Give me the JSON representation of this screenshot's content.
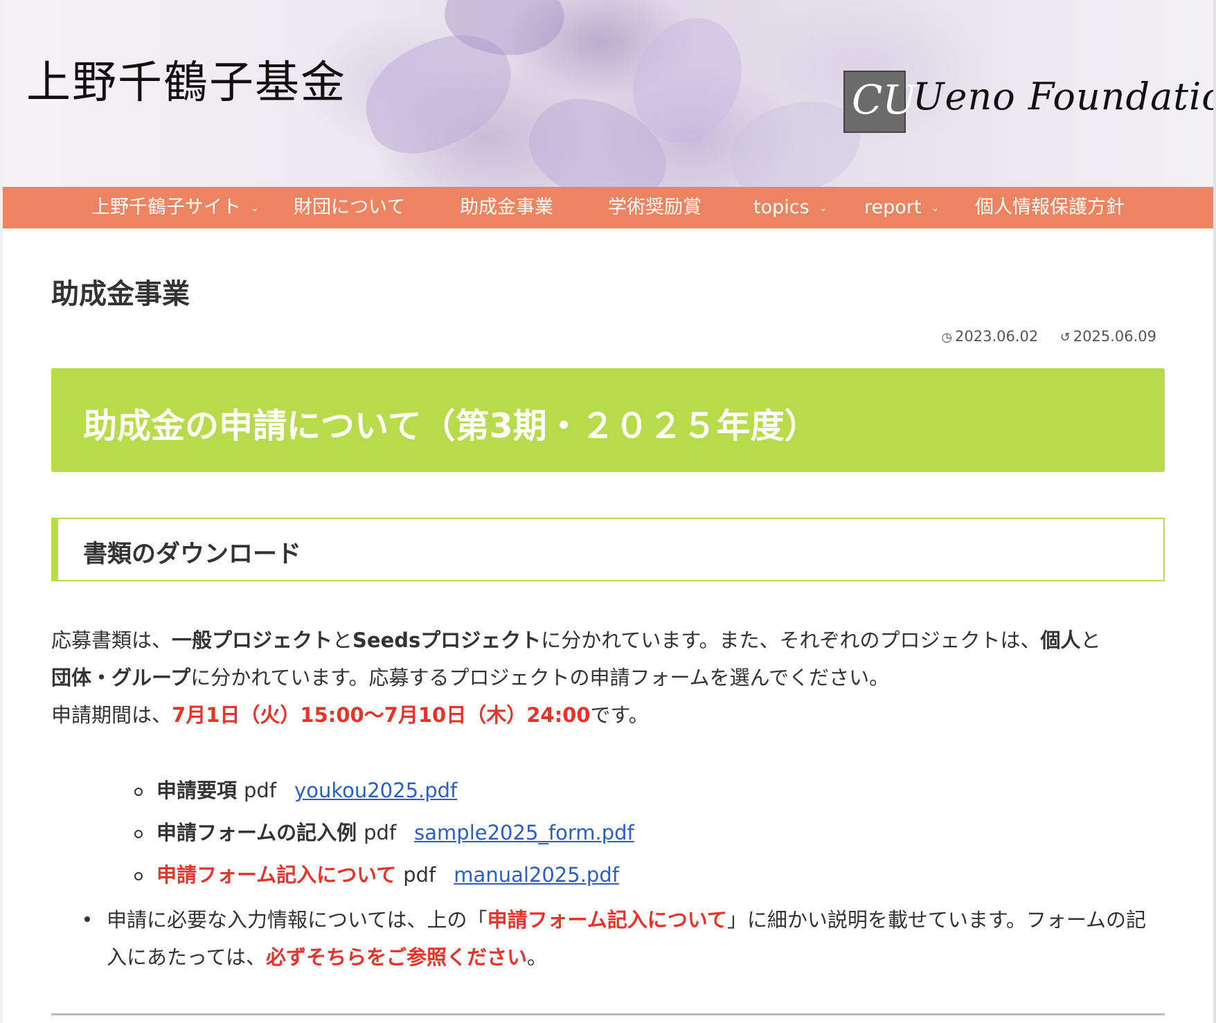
{
  "header": {
    "site_title": "上野千鶴子基金",
    "logo_mark": "CU",
    "logo_text": "Ueno Foundation"
  },
  "nav": {
    "items": [
      {
        "label": "上野千鶴子サイト",
        "has_dropdown": true
      },
      {
        "label": "財団について",
        "has_dropdown": false
      },
      {
        "label": "助成金事業",
        "has_dropdown": false
      },
      {
        "label": "学術奨励賞",
        "has_dropdown": false
      },
      {
        "label": "topics",
        "has_dropdown": true
      },
      {
        "label": "report",
        "has_dropdown": true
      },
      {
        "label": "個人情報保護方針",
        "has_dropdown": false
      }
    ]
  },
  "main": {
    "page_title": "助成金事業",
    "published": "2023.06.02",
    "updated": "2025.06.09",
    "banner_title": "助成金の申請について（第3期・２０２５年度）",
    "section_title": "書類のダウンロード",
    "para": {
      "t1": "応募書類は、",
      "b1": "一般プロジェクト",
      "t2": "と",
      "b2": "Seedsプロジェクト",
      "t3": "に分かれています。また、それぞれのプロジェクトは、",
      "b3": "個人",
      "t4": "と",
      "b4": "団体・グループ",
      "t5": "に分かれています。応募するプロジェクトの申請フォームを選んでください。",
      "t6": "申請期間は、",
      "r1": "7月1日（火）15:00〜7月10日（木）24:00",
      "t7": "です。"
    },
    "downloads": [
      {
        "label": "申請要項",
        "type": "pdf",
        "file": "youkou2025.pdf",
        "highlight": false
      },
      {
        "label": "申請フォームの記入例",
        "type": "pdf",
        "file": "sample2025_form.pdf",
        "highlight": false
      },
      {
        "label": "申請フォーム記入について",
        "type": "pdf",
        "file": "manual2025.pdf",
        "highlight": true
      }
    ],
    "note": {
      "t1": "申請に必要な入力情報については、上の「",
      "r1": "申請フォーム記入について",
      "t2": "」に細かい説明を載せています。フォームの記入にあたっては、",
      "r2": "必ずそちらをご参照ください",
      "t3": "。"
    }
  },
  "colors": {
    "nav_bg": "#ec8462",
    "banner_bg": "#b8db4c",
    "accent_red": "#e8332a",
    "link": "#2b5fc4"
  },
  "icons": {
    "published": "clock-icon",
    "updated": "history-icon",
    "dropdown": "chevron-down-icon"
  }
}
